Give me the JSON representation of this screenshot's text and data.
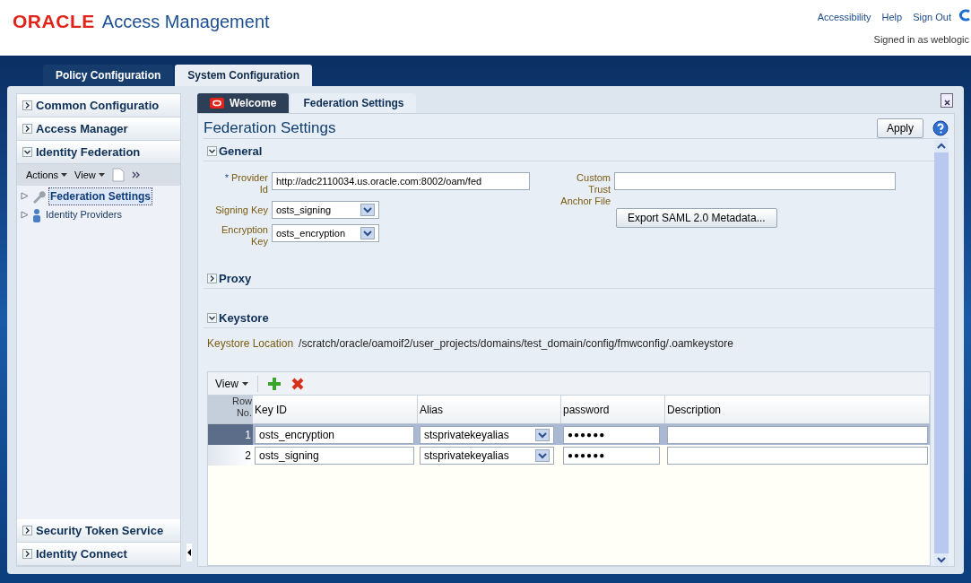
{
  "header": {
    "logo": "ORACLE",
    "product": "Access Management",
    "links": [
      "Accessibility",
      "Help",
      "Sign Out"
    ],
    "signed_in": "Signed in as weblogic"
  },
  "top_tabs": [
    {
      "label": "Policy Configuration",
      "selected": false
    },
    {
      "label": "System Configuration",
      "selected": true
    }
  ],
  "sidebar": {
    "sections": [
      {
        "label": "Common Configuratio",
        "expanded": false
      },
      {
        "label": "Access Manager",
        "expanded": false
      },
      {
        "label": "Identity Federation",
        "expanded": true
      },
      {
        "label": "Security Token Service",
        "expanded": false
      },
      {
        "label": "Identity Connect",
        "expanded": false
      }
    ],
    "toolbar": [
      "Actions",
      "View"
    ],
    "tree": [
      {
        "label": "Federation Settings",
        "selected": true,
        "kind": "wrench"
      },
      {
        "label": "Identity Providers",
        "selected": false,
        "kind": "person"
      }
    ]
  },
  "content_tabs": [
    {
      "label": "Welcome",
      "selected": false
    },
    {
      "label": "Federation Settings",
      "selected": true
    }
  ],
  "page_title": "Federation Settings",
  "apply_button": "Apply",
  "general": {
    "label": "General",
    "expanded": true,
    "provider_id": {
      "required_mark": "*",
      "label": "Provider Id",
      "value": "http://adc2110034.us.oracle.com:8002/oam/fed"
    },
    "signing_key": {
      "label": "Signing Key",
      "value": "osts_signing"
    },
    "encryption_key": {
      "label": "Encryption Key",
      "value": "osts_encryption"
    },
    "custom_trust": {
      "label": "Custom Trust Anchor File"
    },
    "export_button": "Export SAML 2.0 Metadata..."
  },
  "proxy": {
    "label": "Proxy",
    "expanded": false
  },
  "keystore": {
    "label": "Keystore",
    "expanded": true,
    "location_label": "Keystore Location",
    "location": "/scratch/oracle/oamoif2/user_projects/domains/test_domain/config/fmwconfig/.oamkeystore"
  },
  "table": {
    "view_menu": "View",
    "columns": [
      "Row No.",
      "Key ID",
      "Alias",
      "password",
      "Description"
    ],
    "rows": [
      {
        "row_no": "1",
        "key_id": "osts_encryption",
        "alias": "stsprivatekeyalias",
        "password": "●●●●●●",
        "selected": true
      },
      {
        "row_no": "2",
        "key_id": "osts_signing",
        "alias": "stsprivatekeyalias",
        "password": "●●●●●●",
        "selected": false
      }
    ]
  }
}
